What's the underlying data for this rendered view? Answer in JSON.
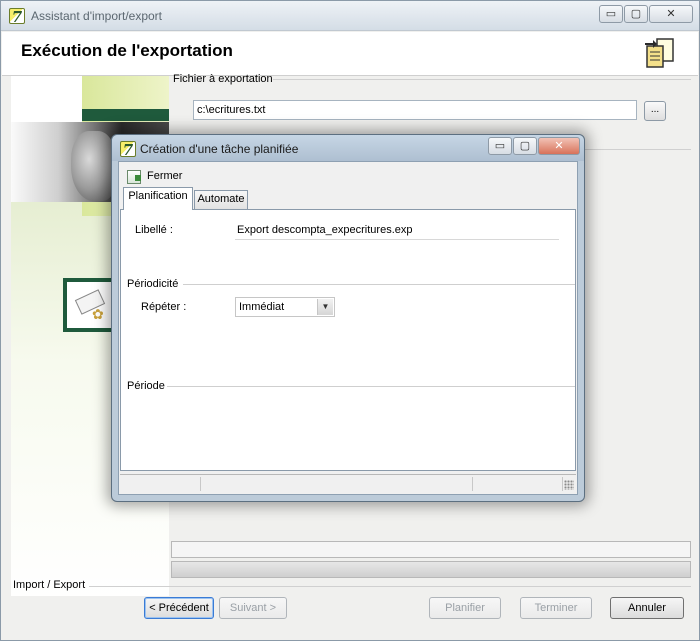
{
  "main_window": {
    "title": "Assistant d'import/export",
    "app_icon": "app-logo-icon",
    "controls": {
      "minimize": "▭",
      "maximize": "▢",
      "close": "✕"
    },
    "heading": "Exécution de l'exportation",
    "header_icon": "export-documents-icon"
  },
  "file_section": {
    "label": "Fichier à exportation",
    "path": "c:\\ecritures.txt",
    "browse_label": "..."
  },
  "footer": {
    "group_label": "Import / Export",
    "buttons": {
      "previous": "< Précédent",
      "next": "Suivant >",
      "schedule": "Planifier",
      "finish": "Terminer",
      "cancel": "Annuler"
    }
  },
  "dialog": {
    "title": "Création d'une tâche planifiée",
    "controls": {
      "minimize": "▭",
      "maximize": "▢",
      "close": "✕"
    },
    "toolbar": {
      "close_label": "Fermer"
    },
    "tabs": [
      {
        "label": "Planification",
        "active": true
      },
      {
        "label": "Automate",
        "active": false
      }
    ],
    "planning": {
      "name_label": "Libellé :",
      "name_value": "Export descompta_expecritures.exp",
      "periodicity_label": "Périodicité",
      "repeat_label": "Répéter :",
      "repeat_value": "Immédiat",
      "period_label": "Période"
    }
  },
  "colors": {
    "accent_green": "#1f5a3c",
    "light_green": "#d9e79b",
    "dialog_frame": "#bccbd9",
    "close_red": "#d8725a"
  }
}
